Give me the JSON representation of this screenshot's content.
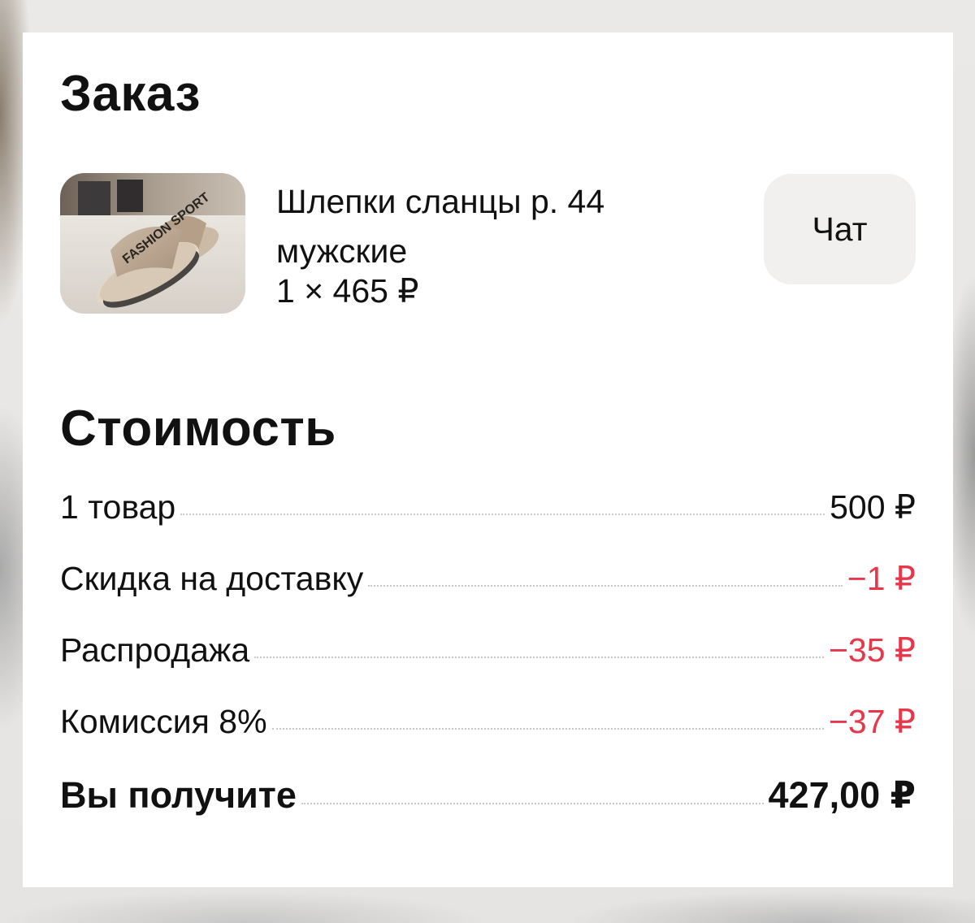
{
  "order": {
    "title": "Заказ",
    "product": {
      "name": "Шлепки сланцы р. 44 мужские",
      "quantity_price": "1 × 465 ₽",
      "image_text": "FASHION SPORT"
    },
    "chat_button_label": "Чат"
  },
  "cost": {
    "title": "Стоимость",
    "rows": [
      {
        "label": "1 товар",
        "value": "500 ₽"
      },
      {
        "label": "Скидка на доставку",
        "value": "−1 ₽"
      },
      {
        "label": "Распродажа",
        "value": "−35 ₽"
      },
      {
        "label": "Комиссия 8%",
        "value": "−37 ₽"
      }
    ],
    "total": {
      "label": "Вы получите",
      "value": "427,00 ₽"
    }
  },
  "colors": {
    "discount": "#e8364a",
    "chat_button_bg": "#f1f0ef"
  }
}
